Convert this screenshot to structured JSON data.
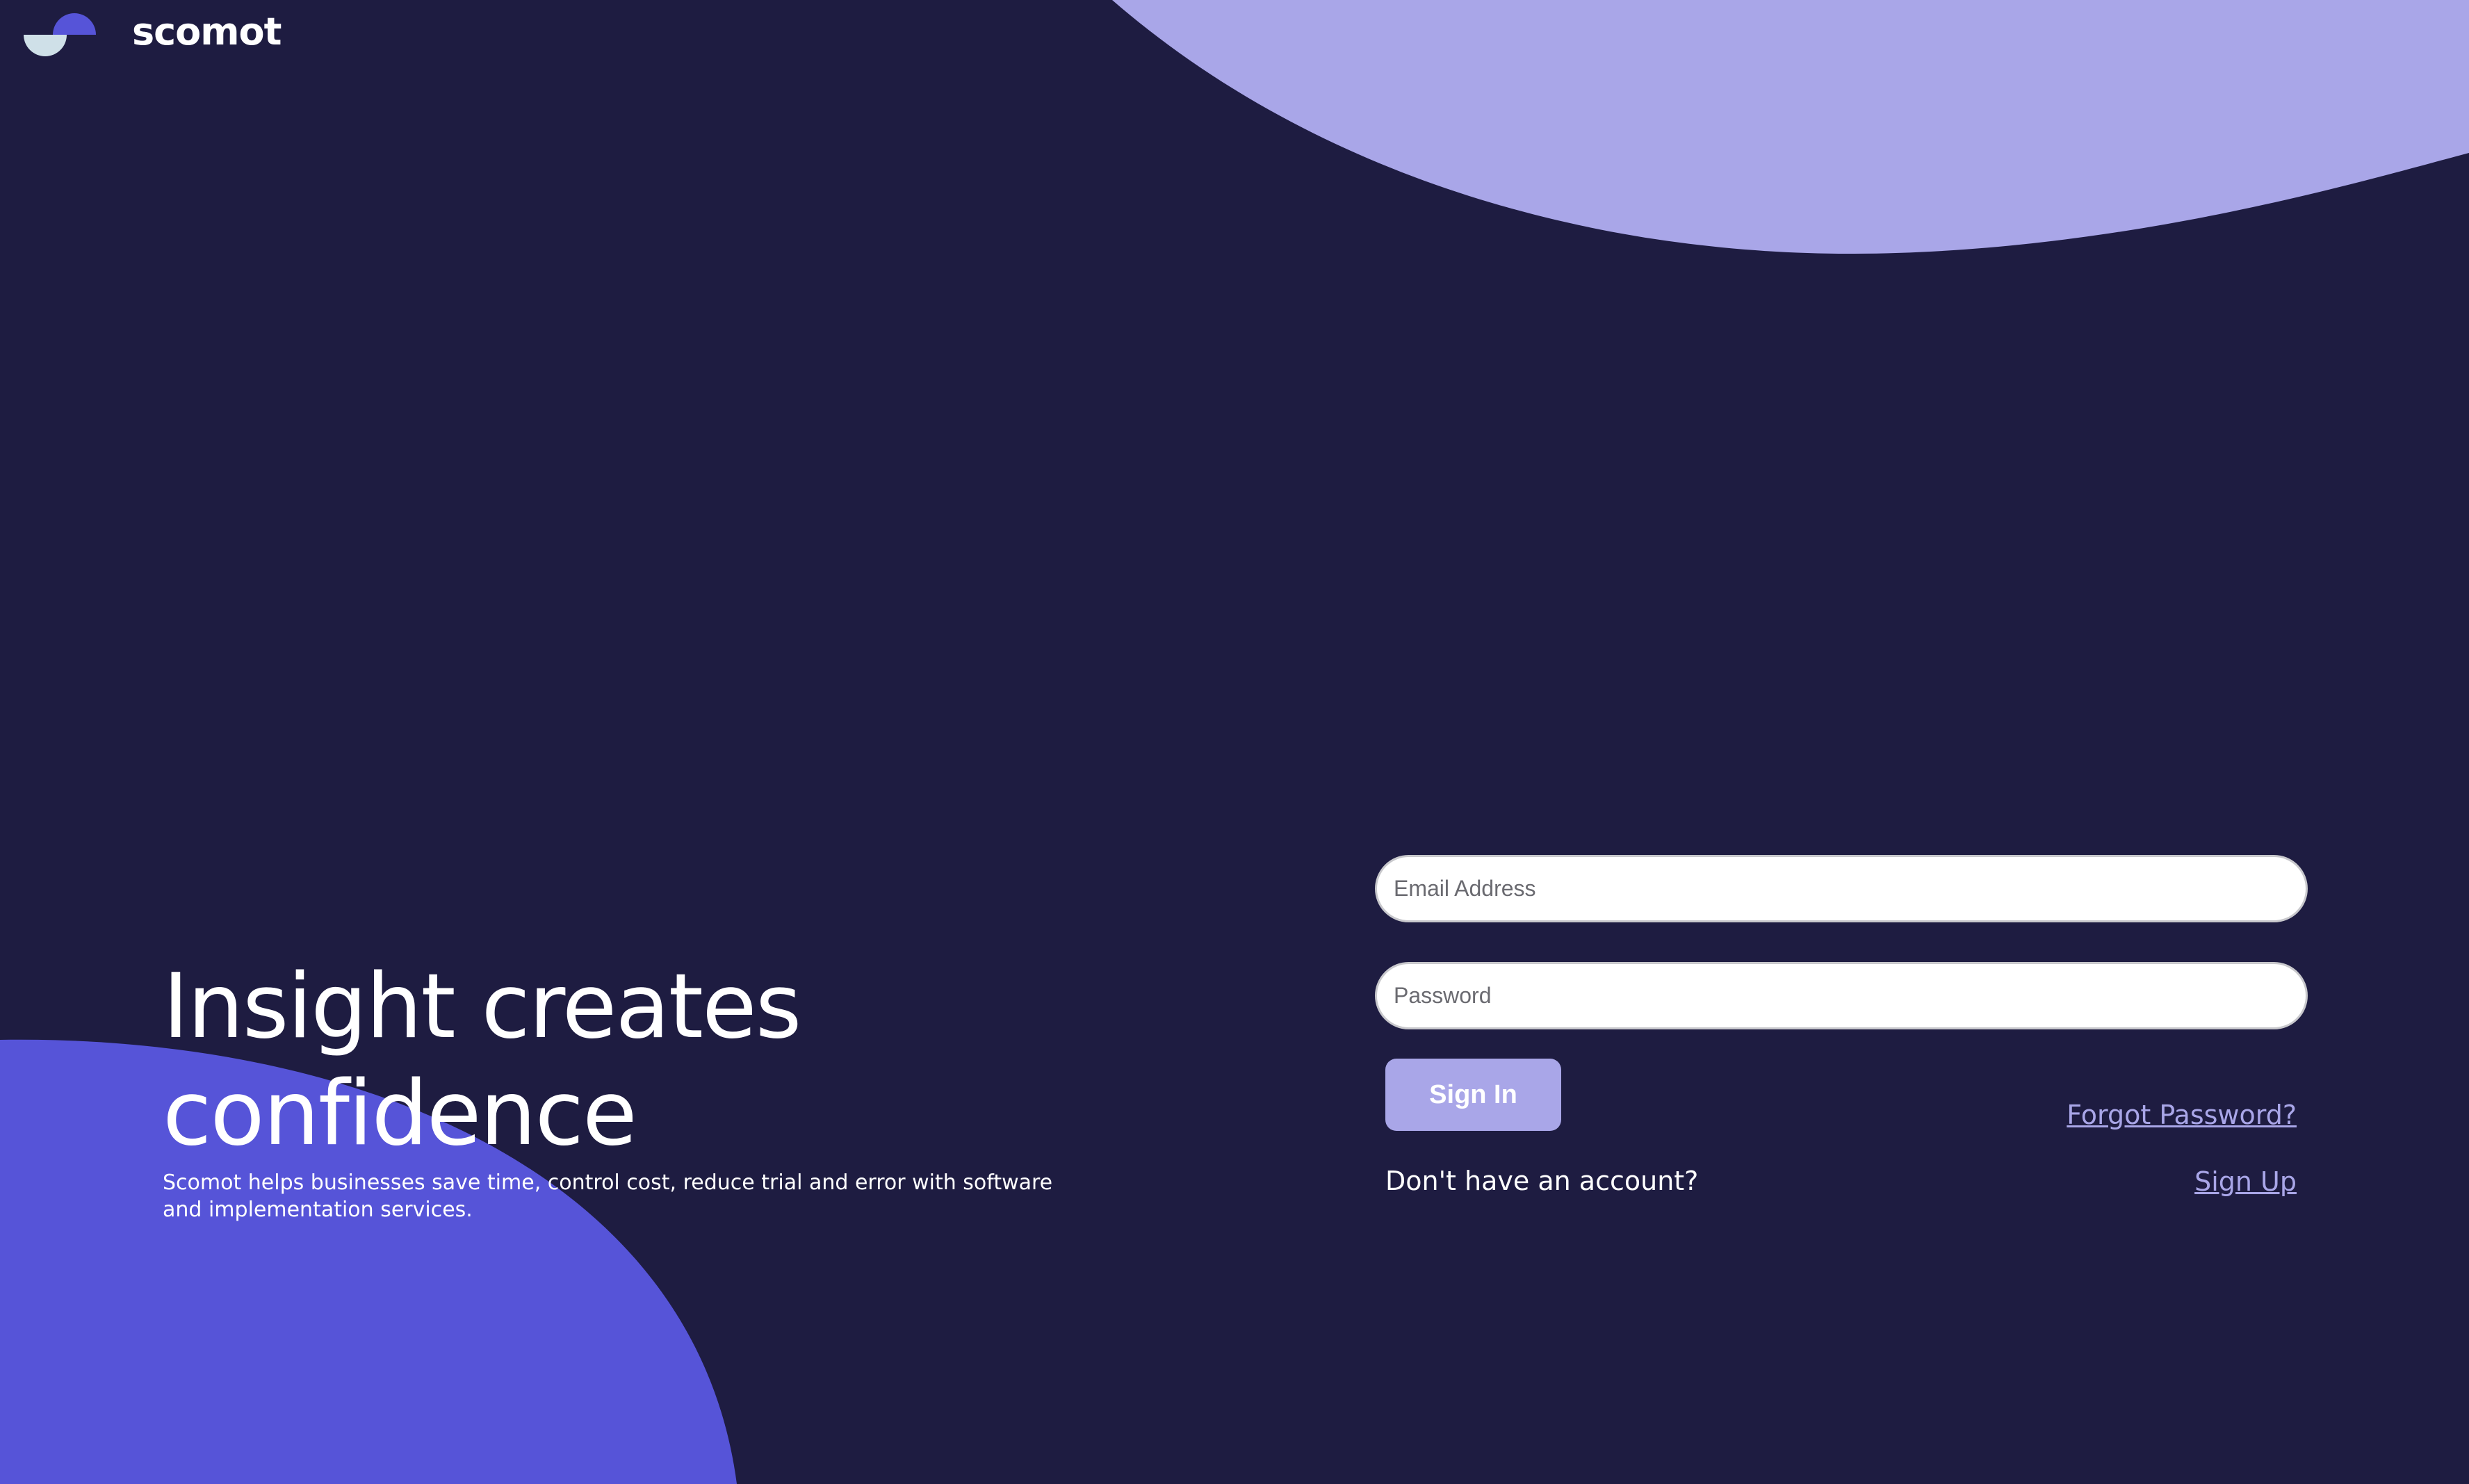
{
  "brand": {
    "name": "scomot",
    "logo_icon": "half-circles-logo-icon"
  },
  "hero": {
    "title": "Insight creates confidence",
    "subtitle": "Scomot helps businesses save time, control cost, reduce trial and error with software and implementation services."
  },
  "login_form": {
    "email": {
      "placeholder": "Email Address",
      "value": ""
    },
    "password": {
      "placeholder": "Password",
      "value": ""
    },
    "sign_in_label": "Sign In",
    "forgot_password_label": "Forgot Password?",
    "no_account_text": "Don't have an account?",
    "sign_up_label": "Sign Up"
  },
  "colors": {
    "background": "#1e1c41",
    "accent_light": "#a9a6e8",
    "accent_dark": "#5654d8",
    "logo_light": "#cfe0e8",
    "text": "#ffffff"
  }
}
